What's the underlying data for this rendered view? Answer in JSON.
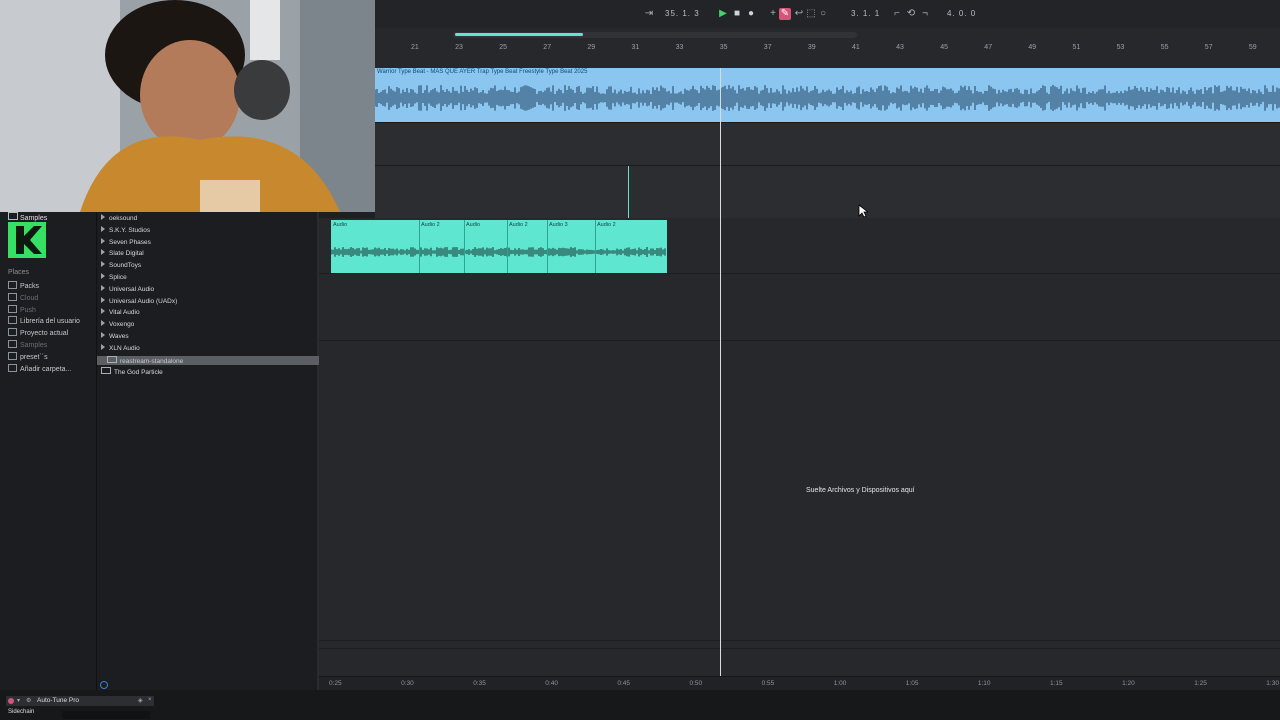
{
  "transport": {
    "position": "35. 1. 3",
    "loop_start": "3. 1. 1",
    "loop_length": "4. 0. 0"
  },
  "ruler": {
    "bars": [
      "21",
      "23",
      "25",
      "27",
      "29",
      "31",
      "33",
      "35",
      "37",
      "39",
      "41",
      "43",
      "45",
      "47",
      "49",
      "51",
      "53",
      "55",
      "57",
      "59"
    ]
  },
  "tracks": {
    "beat_clip_title": "Warrior Type Beat - MÁS QUE AYER Trap Type Beat Freestyle Type Beat 2025",
    "audio_clips": [
      "Audio",
      "Audio 2",
      "Audio",
      "Audio 2",
      "Audio 3",
      "Audio 2"
    ]
  },
  "browser": {
    "header": "Samples",
    "places_label": "Places",
    "places": [
      "Packs",
      "Cloud",
      "Push",
      "Librería del usuario",
      "Proyecto actual",
      "Samples",
      "preset`´s",
      "Añadir carpeta..."
    ],
    "folders": [
      "oeksound",
      "S.K.Y. Studios",
      "Seven Phases",
      "Slate Digital",
      "SoundToys",
      "Splice",
      "Universal Audio",
      "Universal Audio (UADx)",
      "Vital Audio",
      "Voxengo",
      "Waves",
      "XLN Audio",
      "reastream-standalone",
      "The God Particle"
    ]
  },
  "main": {
    "drop_hint": "Suelte Archivos y Dispositivos aquí"
  },
  "timeline": {
    "labels": [
      "0:25",
      "0:30",
      "0:35",
      "0:40",
      "0:45",
      "0:50",
      "0:55",
      "1:00",
      "1:05",
      "1:10",
      "1:15",
      "1:20",
      "1:25",
      "1:30"
    ]
  },
  "device": {
    "name": "Auto-Tune Pro",
    "sidechain_label": "Sidechain"
  },
  "colors": {
    "beat_clip": "#8ac6ef",
    "audio_clip": "#5fe6d0",
    "accent": "#d6547a"
  }
}
